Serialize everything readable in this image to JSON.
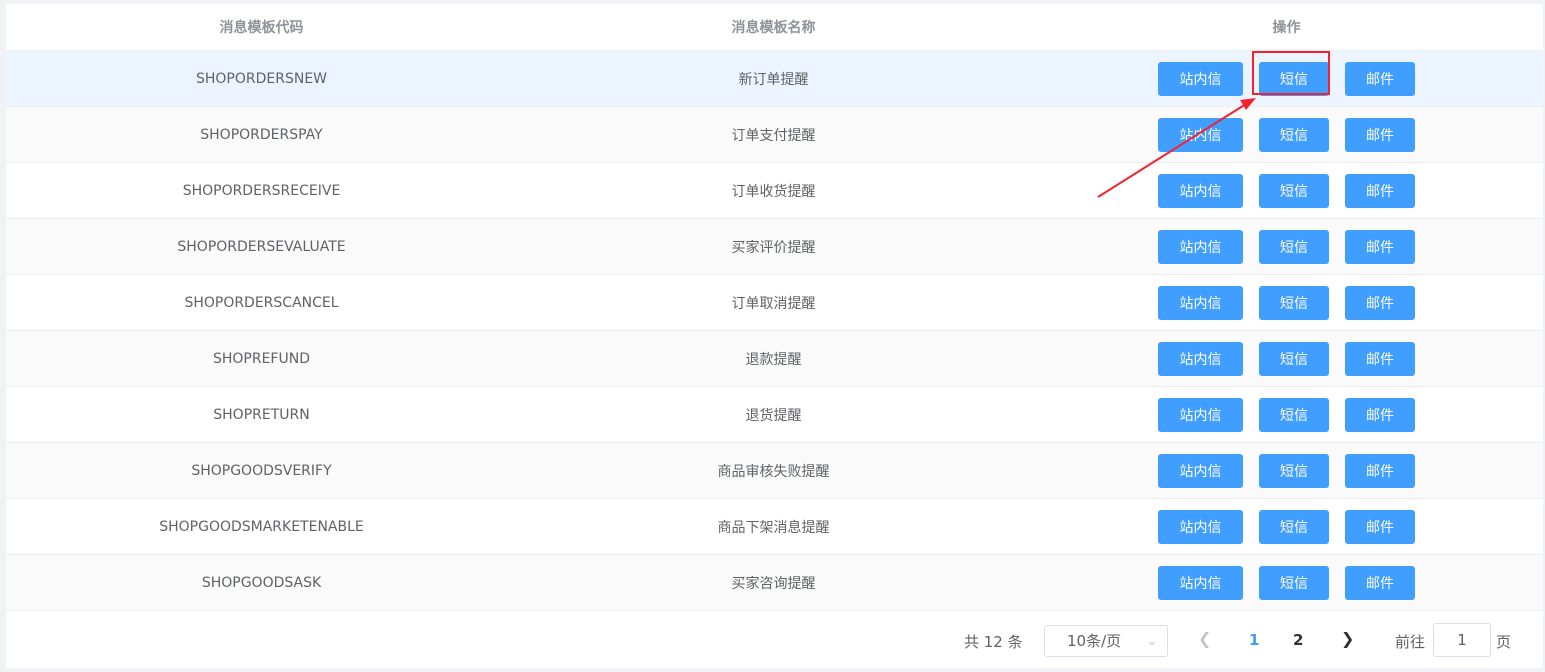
{
  "table": {
    "headers": [
      "消息模板代码",
      "消息模板名称",
      "操作"
    ],
    "rows": [
      {
        "code": "SHOPORDERSNEW",
        "name": "新订单提醒"
      },
      {
        "code": "SHOPORDERSPAY",
        "name": "订单支付提醒"
      },
      {
        "code": "SHOPORDERSRECEIVE",
        "name": "订单收货提醒"
      },
      {
        "code": "SHOPORDERSEVALUATE",
        "name": "买家评价提醒"
      },
      {
        "code": "SHOPORDERSCANCEL",
        "name": "订单取消提醒"
      },
      {
        "code": "SHOPREFUND",
        "name": "退款提醒"
      },
      {
        "code": "SHOPRETURN",
        "name": "退货提醒"
      },
      {
        "code": "SHOPGOODSVERIFY",
        "name": "商品审核失败提醒"
      },
      {
        "code": "SHOPGOODSMARKETENABLE",
        "name": "商品下架消息提醒"
      },
      {
        "code": "SHOPGOODSASK",
        "name": "买家咨询提醒"
      }
    ],
    "actions": {
      "site_message": "站内信",
      "sms": "短信",
      "email": "邮件"
    }
  },
  "pagination": {
    "total_text": "共 12 条",
    "page_size": "10条/页",
    "pages": [
      "1",
      "2"
    ],
    "current_page": "1",
    "goto_label": "前往",
    "goto_value": "1",
    "page_unit": "页"
  },
  "colors": {
    "primary": "#409eff",
    "annotation": "#f5222d"
  }
}
